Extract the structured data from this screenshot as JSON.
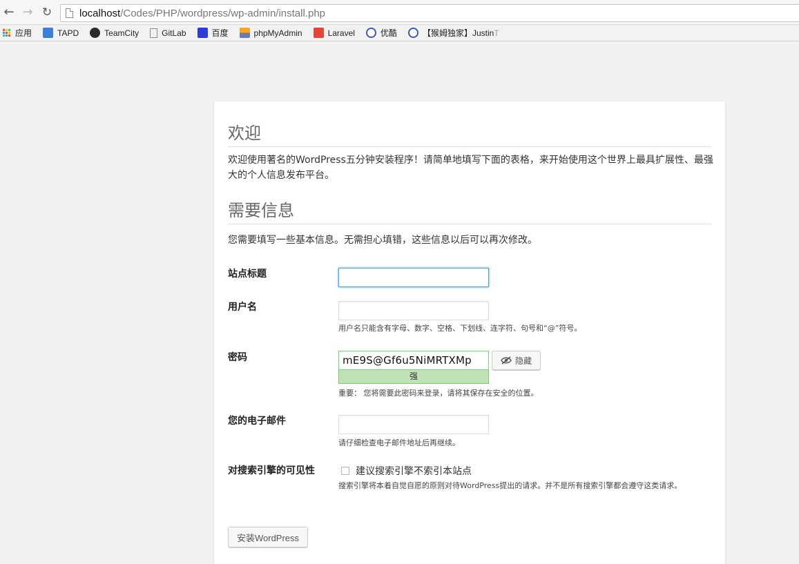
{
  "browser": {
    "url_host": "localhost",
    "url_path": "/Codes/PHP/wordpress/wp-admin/install.php",
    "bookmarks": [
      {
        "label": "应用",
        "icon": "apps-grid-icon"
      },
      {
        "label": "TAPD",
        "icon": "tapd-icon"
      },
      {
        "label": "TeamCity",
        "icon": "teamcity-icon"
      },
      {
        "label": "GitLab",
        "icon": "page-icon"
      },
      {
        "label": "百度",
        "icon": "baidu-paw-icon"
      },
      {
        "label": "phpMyAdmin",
        "icon": "phpmyadmin-icon"
      },
      {
        "label": "Laravel",
        "icon": "laravel-icon"
      },
      {
        "label": "优酷",
        "icon": "play-circle-icon"
      },
      {
        "label": "【猴姆独家】Justin",
        "icon": "play-circle-icon",
        "faded_suffix": "T"
      }
    ]
  },
  "welcome": {
    "heading": "欢迎",
    "text": "欢迎使用著名的WordPress五分钟安装程序！请简单地填写下面的表格，来开始使用这个世界上最具扩展性、最强大的个人信息发布平台。"
  },
  "info": {
    "heading": "需要信息",
    "text": "您需要填写一些基本信息。无需担心填错，这些信息以后可以再次修改。"
  },
  "form": {
    "site_title": {
      "label": "站点标题",
      "value": ""
    },
    "username": {
      "label": "用户名",
      "value": "",
      "hint": "用户名只能含有字母、数字、空格、下划线、连字符、句号和“@”符号。"
    },
    "password": {
      "label": "密码",
      "value": "mE9S@Gf6u5NiMRTXMp",
      "strength": "强",
      "hide_label": "隐藏",
      "hint": "重要： 您将需要此密码来登录，请将其保存在安全的位置。"
    },
    "email": {
      "label": "您的电子邮件",
      "value": "",
      "hint": "请仔细检查电子邮件地址后再继续。"
    },
    "visibility": {
      "label": "对搜索引擎的可见性",
      "checkbox_label": "建议搜索引擎不索引本站点",
      "checked": false,
      "hint": "搜索引擎将本着自觉自愿的原则对待WordPress提出的请求。并不是所有搜索引擎都会遵守这类请求。"
    },
    "submit_label": "安装WordPress"
  },
  "colors": {
    "page_bg": "#f1f1f1",
    "focus_blue": "#5b9dd9",
    "strong_green": "#c1e1b9"
  }
}
